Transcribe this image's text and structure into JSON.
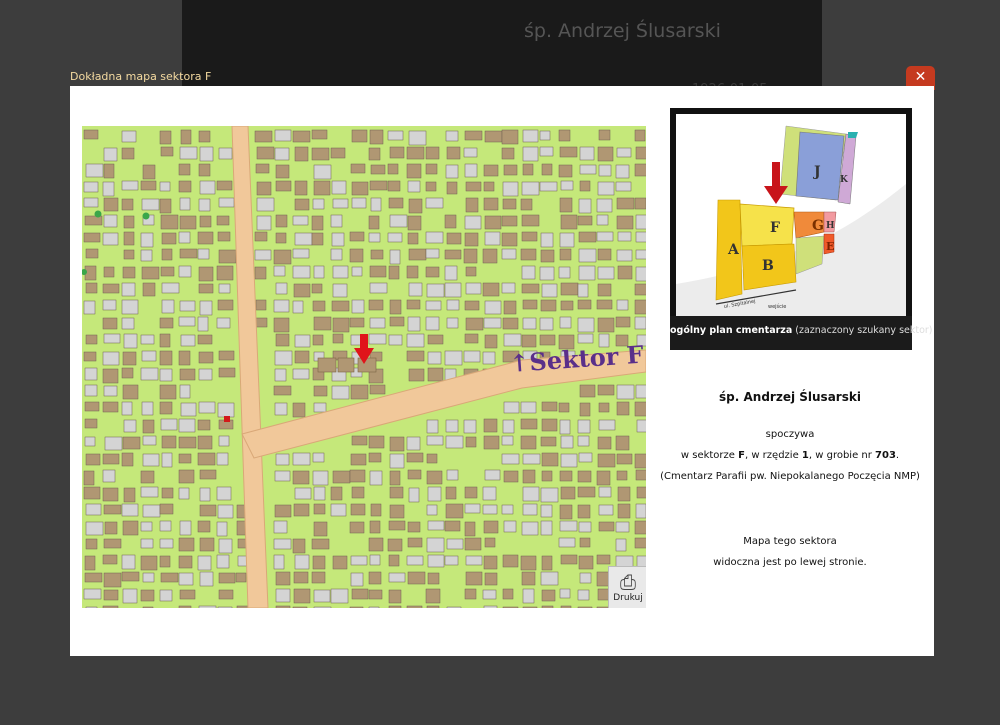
{
  "background": {
    "name": "śp. Andrzej Ślusarski",
    "date_partial": "1926-01-05"
  },
  "lightbox": {
    "caption": "Dokładna mapa sektora F",
    "close_icon": "close-icon"
  },
  "map": {
    "sector_label": "Sektor F",
    "arrow_icon": "red-down-arrow-icon",
    "print_label": "Drukuj",
    "print_icon": "printer-icon",
    "colors": {
      "ground": "#c5e87a",
      "path": "#f1c89a",
      "grave": "#b09773",
      "grave_light": "#d4d4d4",
      "label": "#5a2f8a"
    }
  },
  "overview": {
    "sectors": [
      "A",
      "B",
      "F",
      "G",
      "H",
      "E",
      "J",
      "K"
    ],
    "street": "ul. Szpitalnej",
    "entrance": "wejście",
    "caption_bold": "ogólny plan cmentarza",
    "caption_rest": "(zaznaczony szukany sektor)"
  },
  "info": {
    "name": "śp. Andrzej Ślusarski",
    "rests": "spoczywa",
    "loc_pre": "w sektorze ",
    "sector": "F",
    "loc_row": ", w rzędzie ",
    "row": "1",
    "loc_grave": ", w grobie nr ",
    "grave": "703",
    "loc_end": ".",
    "cemetery": "(Cmentarz Parafii pw. Niepokalanego Poczęcia NMP)",
    "map_line1": "Mapa tego sektora",
    "map_line2": "widoczna jest po lewej stronie."
  }
}
